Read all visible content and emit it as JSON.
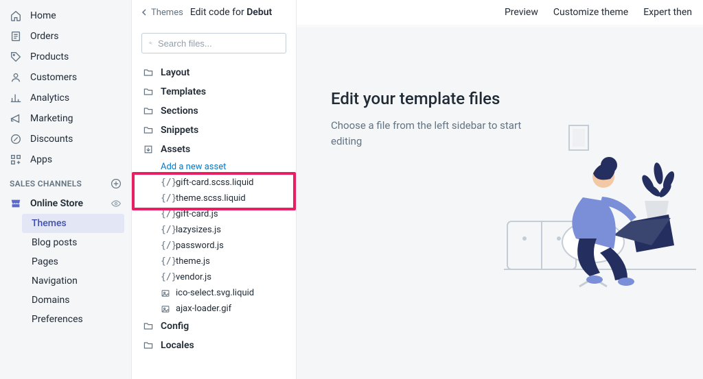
{
  "sidebar": {
    "items": [
      {
        "icon": "home",
        "label": "Home"
      },
      {
        "icon": "orders",
        "label": "Orders"
      },
      {
        "icon": "products",
        "label": "Products"
      },
      {
        "icon": "customers",
        "label": "Customers"
      },
      {
        "icon": "analytics",
        "label": "Analytics"
      },
      {
        "icon": "marketing",
        "label": "Marketing"
      },
      {
        "icon": "discounts",
        "label": "Discounts"
      },
      {
        "icon": "apps",
        "label": "Apps"
      }
    ],
    "sales_channels_label": "SALES CHANNELS",
    "channel": {
      "label": "Online Store"
    },
    "subnav": [
      {
        "label": "Themes",
        "active": true
      },
      {
        "label": "Blog posts"
      },
      {
        "label": "Pages"
      },
      {
        "label": "Navigation"
      },
      {
        "label": "Domains"
      },
      {
        "label": "Preferences"
      }
    ]
  },
  "header": {
    "back_label": "Themes",
    "title_prefix": "Edit code for ",
    "title_theme": "Debut",
    "actions": [
      "Preview",
      "Customize theme",
      "Expert then"
    ]
  },
  "files": {
    "search_placeholder": "Search files...",
    "folders": [
      {
        "label": "Layout"
      },
      {
        "label": "Templates"
      },
      {
        "label": "Sections"
      },
      {
        "label": "Snippets"
      },
      {
        "label": "Assets",
        "open": true,
        "add_label": "Add a new asset",
        "files": [
          {
            "icon": "code",
            "name": "gift-card.scss.liquid",
            "highlighted": true
          },
          {
            "icon": "code",
            "name": "theme.scss.liquid",
            "highlighted": true
          },
          {
            "icon": "code",
            "name": "gift-card.js"
          },
          {
            "icon": "code",
            "name": "lazysizes.js"
          },
          {
            "icon": "code",
            "name": "password.js"
          },
          {
            "icon": "code",
            "name": "theme.js"
          },
          {
            "icon": "code",
            "name": "vendor.js"
          },
          {
            "icon": "image",
            "name": "ico-select.svg.liquid"
          },
          {
            "icon": "image",
            "name": "ajax-loader.gif"
          }
        ]
      },
      {
        "label": "Config"
      },
      {
        "label": "Locales"
      }
    ]
  },
  "editor": {
    "heading": "Edit your template files",
    "subtext": "Choose a file from the left sidebar to start editing"
  }
}
